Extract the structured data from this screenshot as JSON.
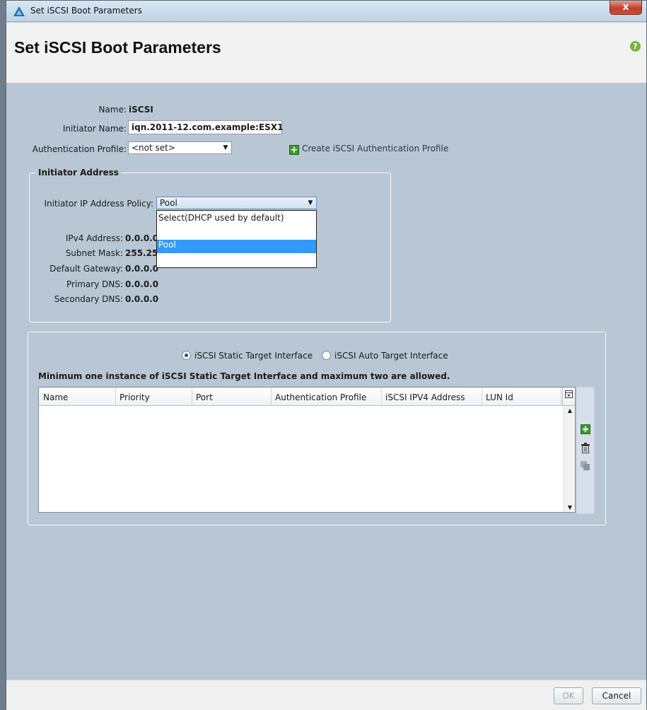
{
  "window": {
    "title": "Set iSCSI Boot Parameters",
    "close_label": "x"
  },
  "header": {
    "title": "Set iSCSI Boot Parameters",
    "help_icon": "?"
  },
  "form": {
    "name_label": "Name:",
    "name_value": "iSCSI",
    "initiator_name_label": "Initiator Name:",
    "initiator_name_value": "iqn.2011-12.com.example:ESX1",
    "auth_profile_label": "Authentication Profile:",
    "auth_profile_value": "<not set>",
    "create_auth_profile_label": "Create iSCSI Authentication Profile"
  },
  "initiator_address": {
    "group_title": "Initiator Address",
    "ip_policy_label": "Initiator IP Address Policy:",
    "ip_policy_value": "Pool",
    "ip_policy_options": [
      "Select(DHCP used by default)",
      "",
      "Pool"
    ],
    "selected_option": "Pool",
    "ipv4_label": "IPv4 Address:",
    "ipv4_value": "0.0.0.0",
    "subnet_label": "Subnet Mask:",
    "subnet_value": "255.255.255.0",
    "gateway_label": "Default Gateway:",
    "gateway_value": "0.0.0.0",
    "primary_dns_label": "Primary DNS:",
    "primary_dns_value": "0.0.0.0",
    "secondary_dns_label": "Secondary DNS:",
    "secondary_dns_value": "0.0.0.0"
  },
  "target": {
    "static_label": "iSCSI Static Target Interface",
    "auto_label": "iSCSI Auto Target Interface",
    "selected": "static",
    "note": "Minimum one instance of iSCSI Static Target Interface and maximum two are allowed.",
    "columns": [
      "Name",
      "Priority",
      "Port",
      "Authentication Profile",
      "iSCSI IPV4 Address",
      "LUN Id"
    ],
    "rows": []
  },
  "footer": {
    "ok_label": "OK",
    "cancel_label": "Cancel"
  }
}
